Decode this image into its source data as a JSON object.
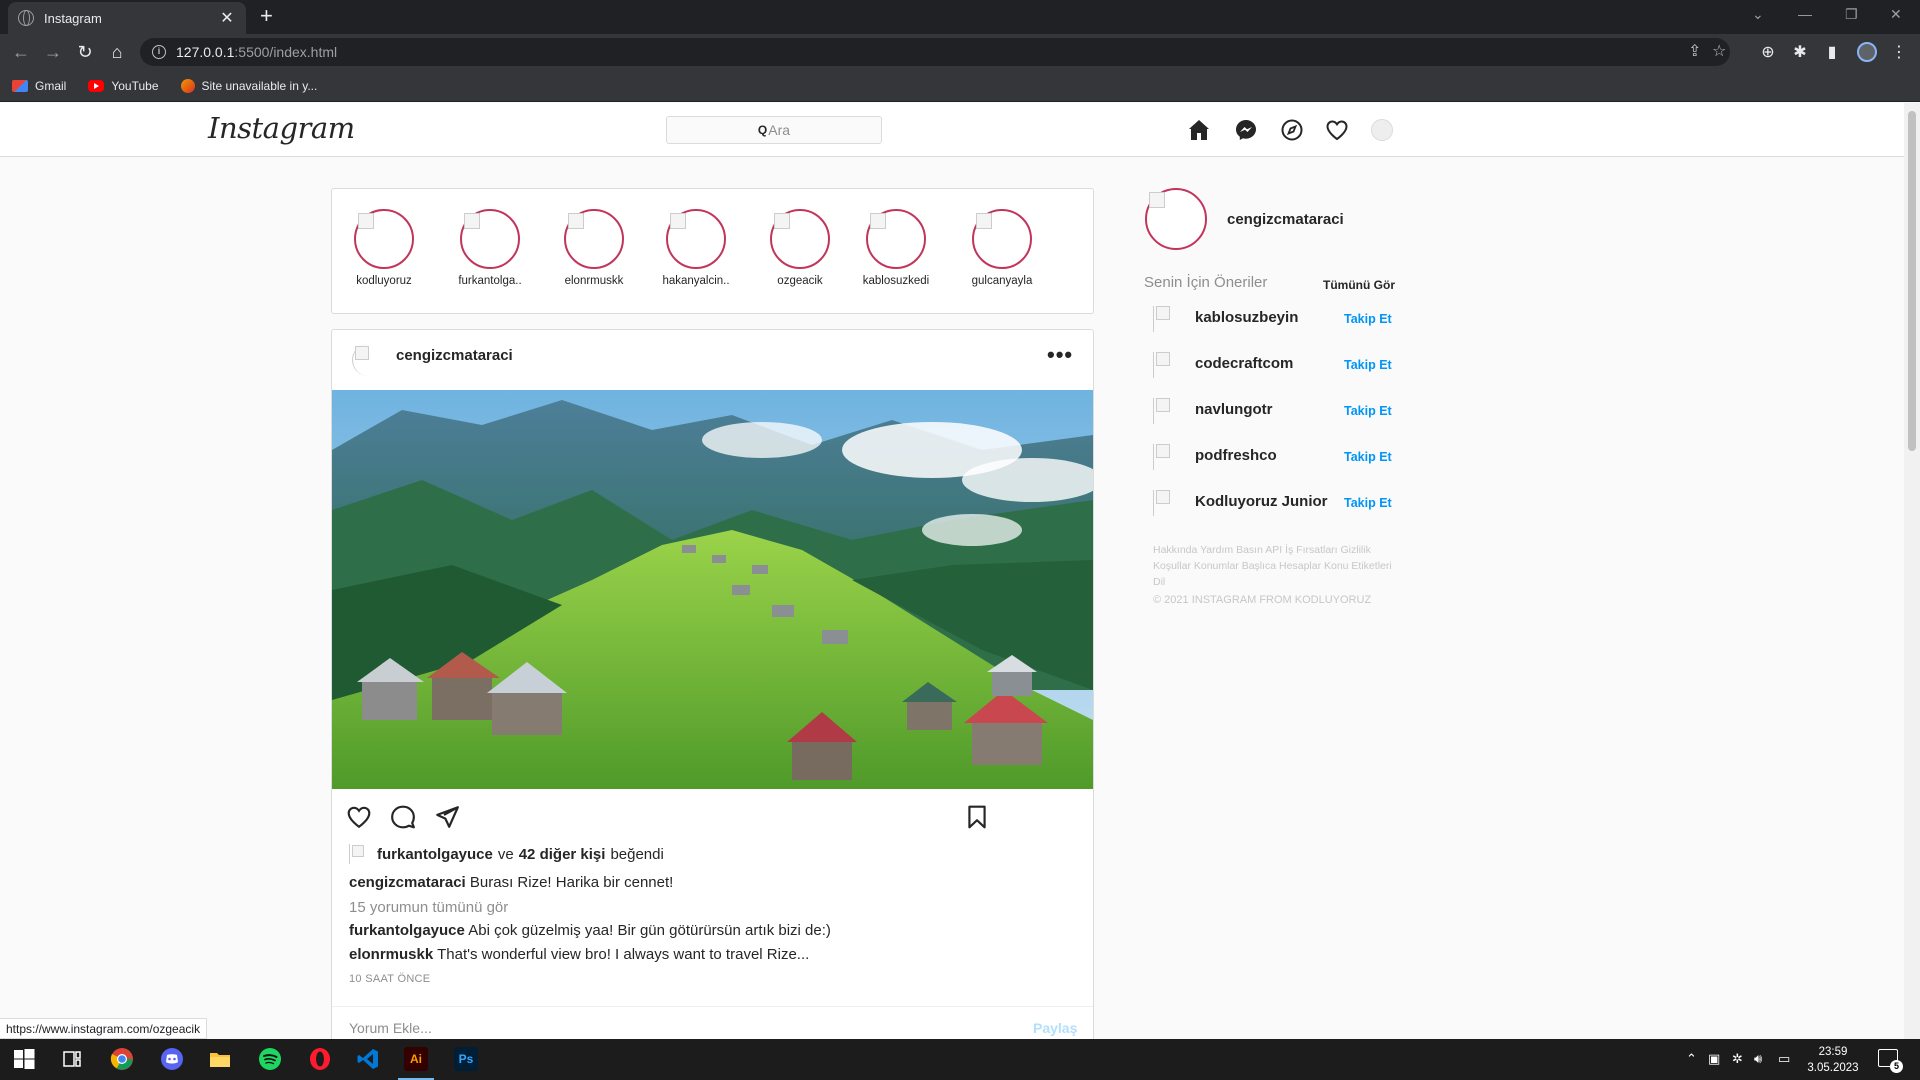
{
  "browser": {
    "tab_title": "Instagram",
    "tab_close": "✕",
    "new_tab": "+",
    "url_host": "127.0.0.1",
    "url_path": ":5500/index.html",
    "bookmarks": [
      {
        "label": "Gmail",
        "icon": "gmail-icon"
      },
      {
        "label": "YouTube",
        "icon": "youtube-icon"
      },
      {
        "label": "Site unavailable in y...",
        "icon": "warning-icon"
      }
    ],
    "status_url": "https://www.instagram.com/ozgeacik"
  },
  "instagram": {
    "logo": "Instagram",
    "search_placeholder": "Ara",
    "stories": [
      {
        "name": "kodluyoruz"
      },
      {
        "name": "furkantolga.."
      },
      {
        "name": "elonrmuskk"
      },
      {
        "name": "hakanyalcin.."
      },
      {
        "name": "ozgeacik"
      },
      {
        "name": "kablosuzkedi"
      },
      {
        "name": "gulcanyayla"
      }
    ],
    "post": {
      "username": "cengizcmataraci",
      "more": "•••",
      "likes_user": "furkantolgayuce",
      "likes_connector": "ve",
      "likes_others": "42 diğer kişi",
      "likes_suffix": "beğendi",
      "caption_user": "cengizcmataraci",
      "caption_text": "Burası Rize! Harika bir cennet!",
      "view_comments": "15 yorumun tümünü gör",
      "comments": [
        {
          "user": "furkantolgayuce",
          "text": "Abi çok güzelmiş yaa! Bir gün götürürsün artık bizi de:)"
        },
        {
          "user": "elonrmuskk",
          "text": "That's wonderful view bro! I always want to travel Rize..."
        }
      ],
      "time": "10 SAAT ÖNCE",
      "comment_placeholder": "Yorum Ekle...",
      "share_label": "Paylaş"
    },
    "sidebar": {
      "username": "cengizcmataraci",
      "suggestions_title": "Senin İçin Öneriler",
      "see_all": "Tümünü Gör",
      "suggestions": [
        {
          "name": "kablosuzbeyin",
          "action": "Takip Et"
        },
        {
          "name": "codecraftcom",
          "action": "Takip Et"
        },
        {
          "name": "navlungotr",
          "action": "Takip Et"
        },
        {
          "name": "podfreshco",
          "action": "Takip Et"
        },
        {
          "name": "Kodluyoruz Junior",
          "action": "Takip Et"
        }
      ],
      "footer_links": "Hakkında Yardım Basın API İş Fırsatları Gizlilik Koşullar Konumlar Başlıca Hesaplar Konu Etiketleri Dil",
      "copyright": "© 2021 INSTAGRAM FROM KODLUYORUZ"
    }
  },
  "taskbar": {
    "apps": [
      "start-icon",
      "task-view-icon",
      "chrome-icon",
      "discord-icon",
      "file-explorer-icon",
      "spotify-icon",
      "opera-icon",
      "vscode-icon",
      "illustrator-icon",
      "photoshop-icon"
    ],
    "ai_label": "Ai",
    "ps_label": "Ps",
    "time": "23:59",
    "date": "3.05.2023",
    "notification_count": "5"
  },
  "colors": {
    "story_ring": "#c1355b",
    "follow_blue": "#0095f6",
    "share_disabled": "#b2dffc"
  }
}
